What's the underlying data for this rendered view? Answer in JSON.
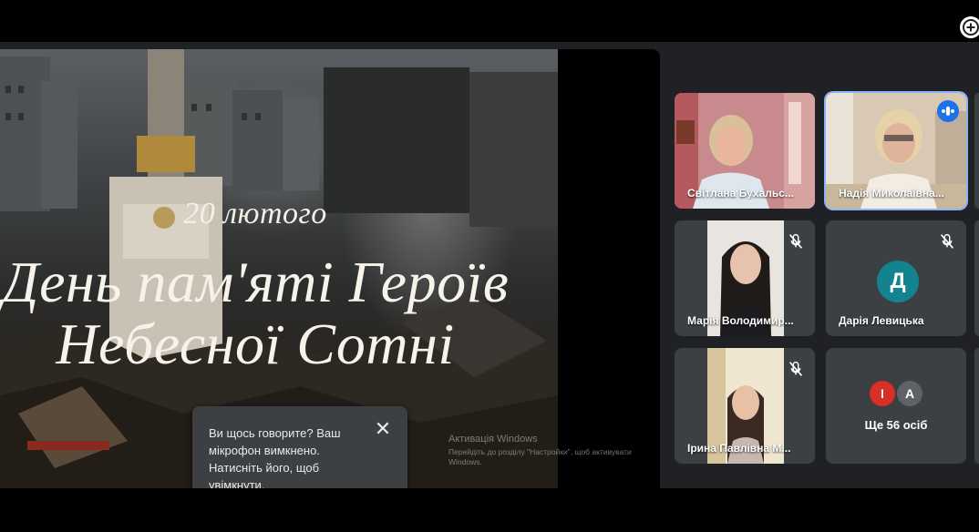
{
  "presentation": {
    "slide_date": "20 лютого",
    "slide_title_line1": "День пам'яті Героїв",
    "slide_title_line2": "Небесної Сотні"
  },
  "watermark": {
    "title": "Активація Windows",
    "subtitle": "Перейдіть до розділу \"Настройки\", щоб активувати Windows."
  },
  "mic_notice": {
    "message": "Ви щось говорите? Ваш мікрофон вимкнено. Натисніть його, щоб увімкнути.",
    "close_icon": "close-icon"
  },
  "participants": [
    {
      "name": "Світлана Бухальс...",
      "muted": false
    },
    {
      "name": "Надія Миколаївна...",
      "muted": false,
      "speaking": true
    },
    {
      "name": "Марія Володимир...",
      "muted": true
    },
    {
      "name": "Дарія Левицька",
      "muted": true,
      "initial": "Д",
      "avatar_color": "#12838f"
    },
    {
      "name": "Ірина Павлівна М...",
      "muted": true
    }
  ],
  "more_participants": {
    "label": "Ще 56 осіб",
    "avatars": [
      {
        "initial": "І",
        "color": "#d93025"
      },
      {
        "initial": "А",
        "color": "#5f6368"
      }
    ]
  },
  "icons": {
    "mic_off": "mic-off-icon",
    "speaking": "audio-level-icon",
    "add": "add-circle-icon"
  }
}
